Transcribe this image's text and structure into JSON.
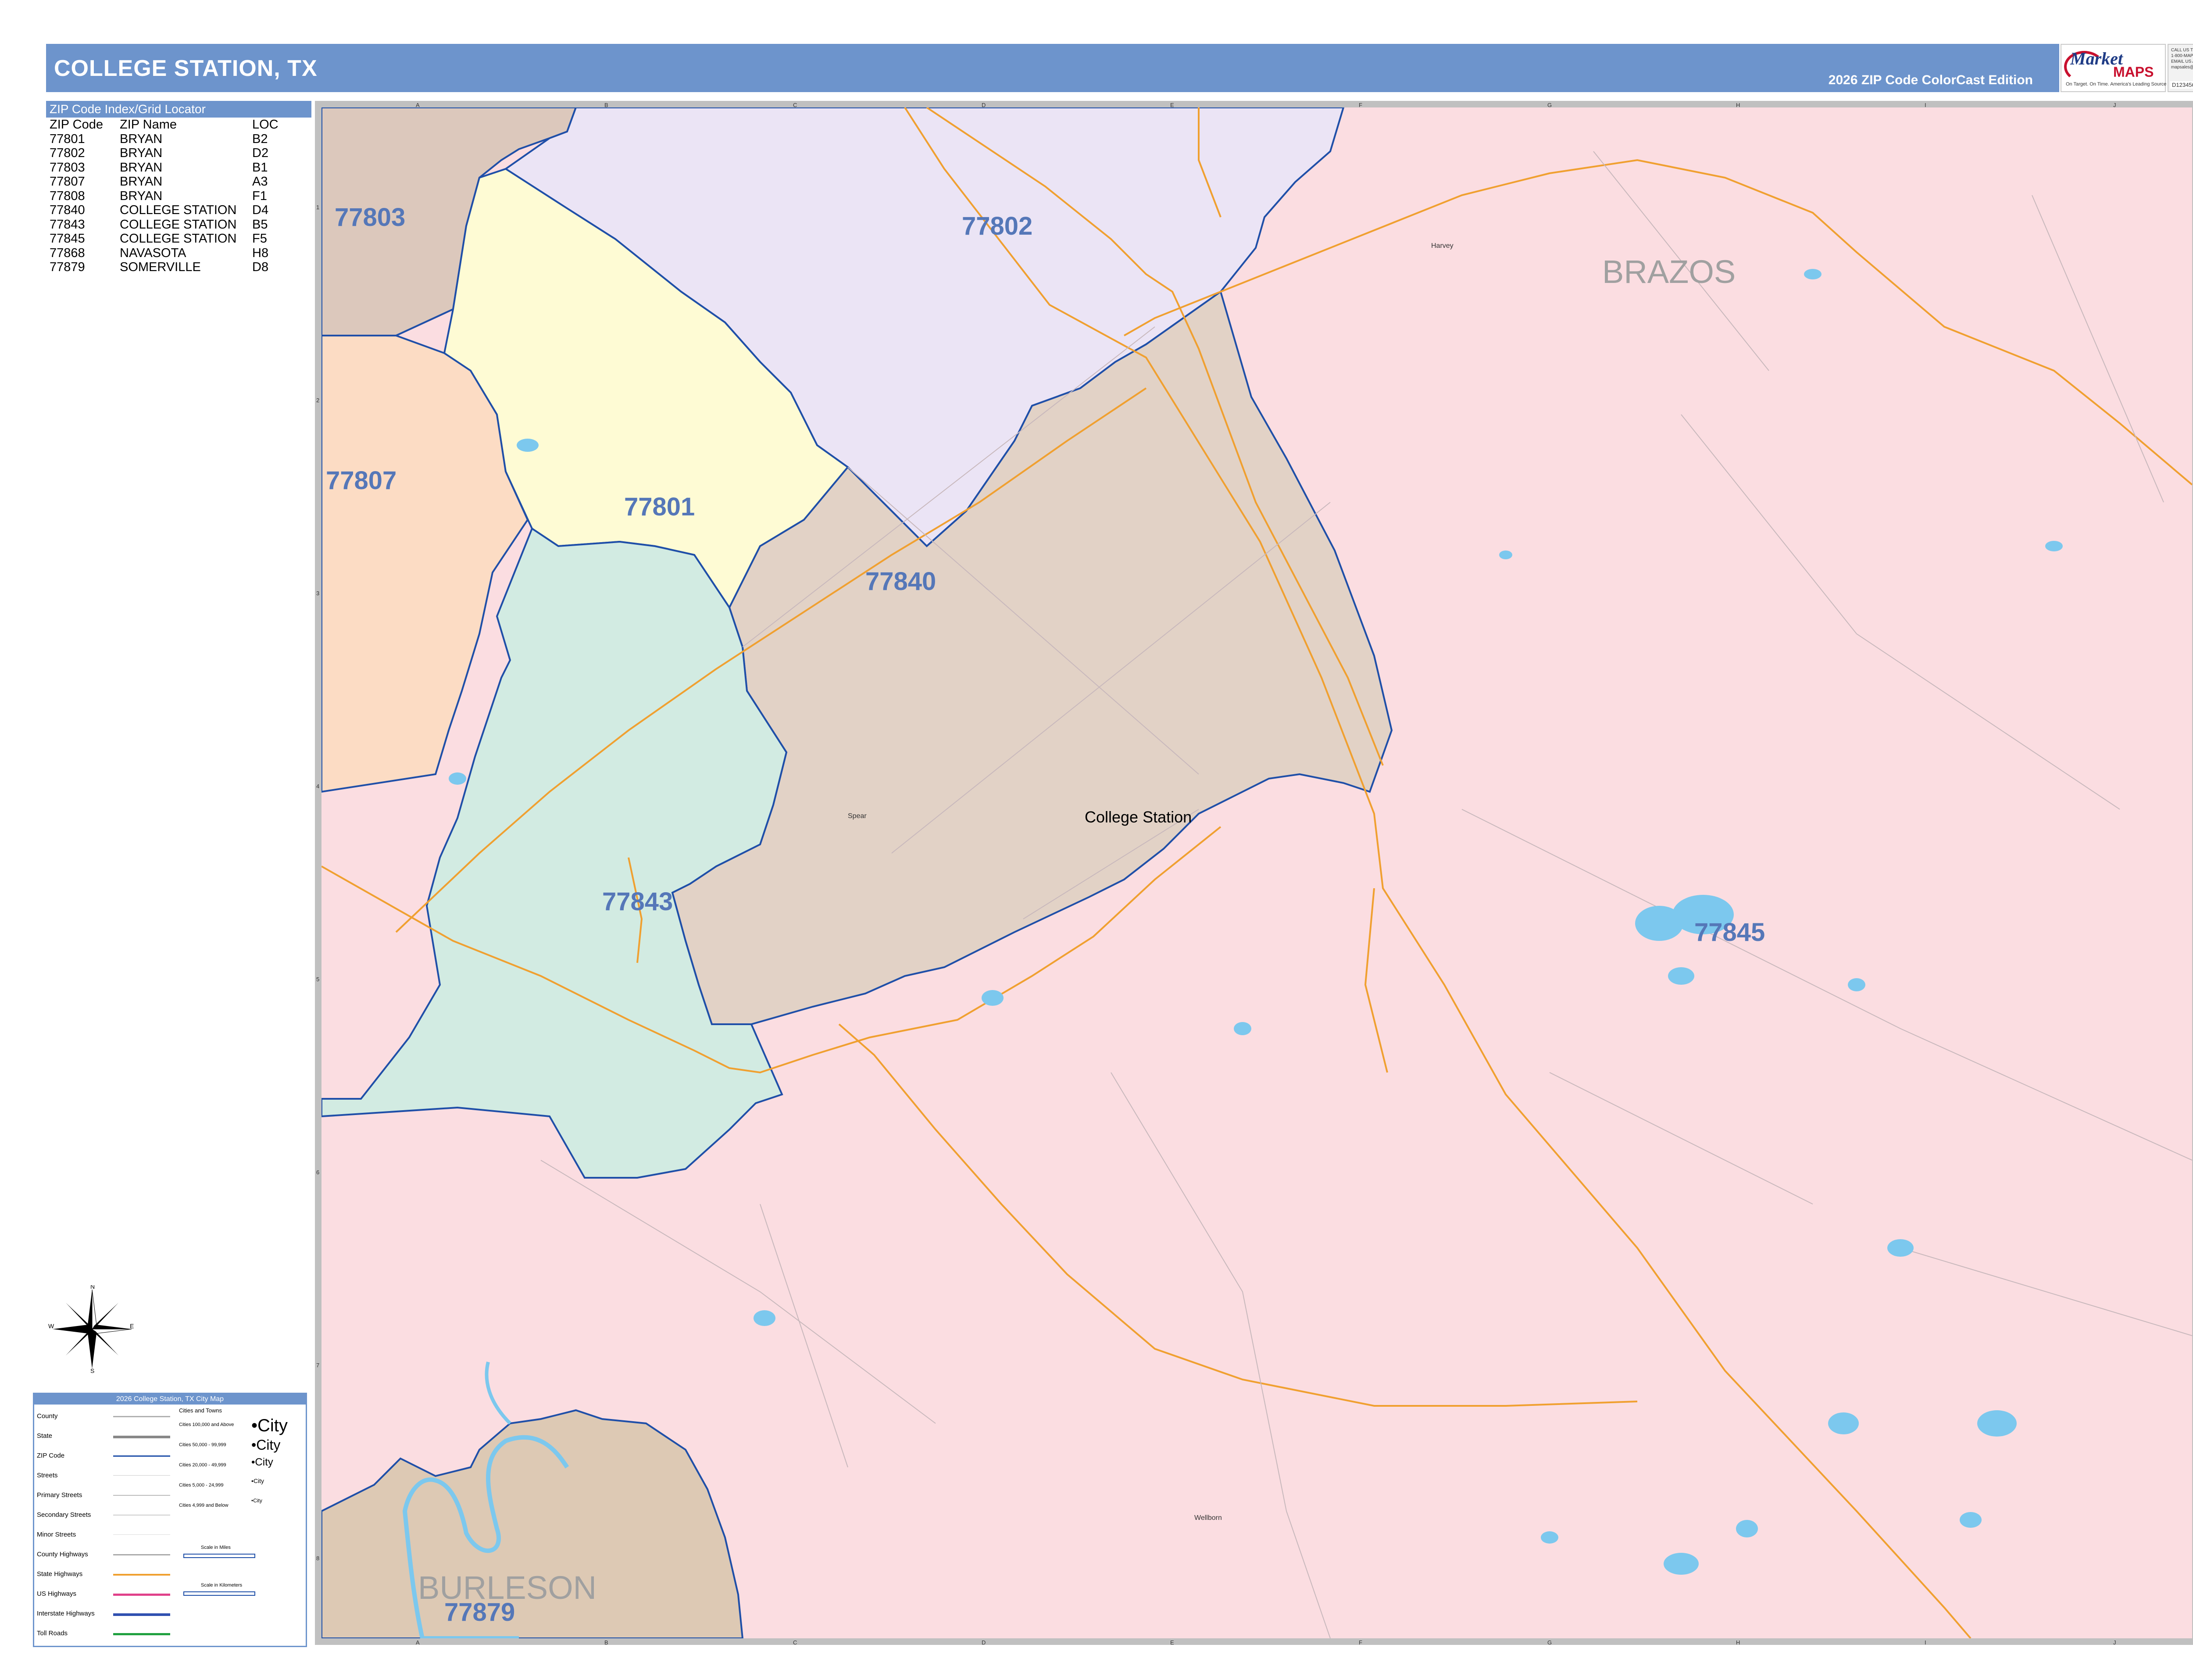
{
  "header": {
    "title": "COLLEGE STATION, TX",
    "edition": "2026 ZIP Code ColorCast Edition",
    "logo": {
      "line1": "Market",
      "line2": "MAPS",
      "tagline": "On Target. On Time. America's Leading Source of Business Maps"
    },
    "contact": {
      "lines": [
        "CALL US TOLL FREE",
        "1-800-MAP-8877",
        "EMAIL US AT",
        "mapsales@marketmaps.com"
      ],
      "code": "D123456"
    }
  },
  "index": {
    "heading": "ZIP Code Index/Grid Locator",
    "columns": [
      "ZIP Code",
      "ZIP Name",
      "LOC"
    ],
    "rows": [
      [
        "77801",
        "BRYAN",
        "B2"
      ],
      [
        "77802",
        "BRYAN",
        "D2"
      ],
      [
        "77803",
        "BRYAN",
        "B1"
      ],
      [
        "77807",
        "BRYAN",
        "A3"
      ],
      [
        "77808",
        "BRYAN",
        "F1"
      ],
      [
        "77840",
        "COLLEGE STATION",
        "D4"
      ],
      [
        "77843",
        "COLLEGE STATION",
        "B5"
      ],
      [
        "77845",
        "COLLEGE STATION",
        "F5"
      ],
      [
        "77868",
        "NAVASOTA",
        "H8"
      ],
      [
        "77879",
        "SOMERVILLE",
        "D8"
      ]
    ]
  },
  "compass": {
    "n": "N",
    "s": "S",
    "e": "E",
    "w": "W"
  },
  "legend": {
    "heading": "2026 College Station, TX City Map",
    "items": [
      "County",
      "State",
      "ZIP Code",
      "Streets",
      "Primary Streets",
      "Secondary Streets",
      "Minor Streets",
      "County Highways",
      "State Highways",
      "US Highways",
      "Interstate Highways",
      "Toll Roads"
    ],
    "cities_heading": "Cities and Towns",
    "cities": [
      "Cities 100,000 and Above",
      "Cities 50,000 - 99,999",
      "Cities 20,000 - 49,999",
      "Cities 5,000 - 24,999",
      "Cities 4,999 and Below"
    ],
    "city_sample": "City",
    "scale_miles": "Scale in Miles",
    "scale_km": "Scale in Kilometers"
  },
  "map": {
    "grid_columns": [
      "A",
      "B",
      "C",
      "D",
      "E",
      "F",
      "G",
      "H",
      "I",
      "J"
    ],
    "grid_rows": [
      "1",
      "2",
      "3",
      "4",
      "5",
      "6",
      "7",
      "8"
    ],
    "zip_labels": [
      "77803",
      "77802",
      "77807",
      "77801",
      "77840",
      "77843",
      "77845",
      "77879"
    ],
    "county_labels": [
      "BRAZOS",
      "BURLESON"
    ],
    "city_label": "College Station",
    "place_labels": [
      "Harvey",
      "Wellborn",
      "Spear"
    ],
    "colors": {
      "zip_77803": "#dcc8bc",
      "zip_77802": "#ebe4f5",
      "zip_77807": "#fcdcc4",
      "zip_77801": "#fefbd4",
      "zip_77840": "#e2d2c6",
      "zip_77843": "#d2ebe2",
      "zip_77845": "#fbdde1",
      "zip_77879": "#ddc9b4",
      "zip_label": "#5577b8",
      "county_label": "#a0a0a0",
      "boundary": "#1f4fa8",
      "highway": "#f0a030",
      "water": "#7cc8ee"
    }
  }
}
